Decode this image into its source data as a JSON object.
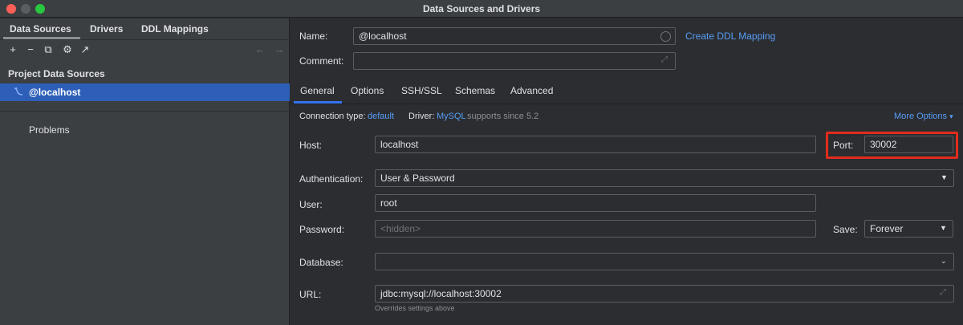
{
  "window": {
    "title": "Data Sources and Drivers"
  },
  "left": {
    "tabs": [
      {
        "label": "Data Sources"
      },
      {
        "label": "Drivers"
      },
      {
        "label": "DDL Mappings"
      }
    ],
    "toolbar": {
      "add": "+",
      "remove": "−",
      "duplicate": "⧉",
      "settings": "⚙",
      "export": "↗",
      "back": "←",
      "forward": "→"
    },
    "section_title": "Project Data Sources",
    "items": [
      {
        "label": "@localhost",
        "icon": "mysql-dolphin-icon"
      }
    ],
    "problems": "Problems"
  },
  "form": {
    "name_label": "Name:",
    "name_value": "@localhost",
    "create_ddl_link": "Create DDL Mapping",
    "comment_label": "Comment:",
    "comment_value": "",
    "tabs": [
      {
        "label": "General"
      },
      {
        "label": "Options"
      },
      {
        "label": "SSH/SSL"
      },
      {
        "label": "Schemas"
      },
      {
        "label": "Advanced"
      }
    ],
    "connection_type_label": "Connection type:",
    "connection_type_value": "default",
    "driver_label": "Driver:",
    "driver_value": "MySQL",
    "driver_note": "supports since 5.2",
    "more_options": "More Options",
    "host_label": "Host:",
    "host_value": "localhost",
    "port_label": "Port:",
    "port_value": "30002",
    "auth_label": "Authentication:",
    "auth_value": "User & Password",
    "user_label": "User:",
    "user_value": "root",
    "password_label": "Password:",
    "password_placeholder": "<hidden>",
    "save_label": "Save:",
    "save_value": "Forever",
    "database_label": "Database:",
    "database_value": "",
    "url_label": "URL:",
    "url_value": "jdbc:mysql://localhost:30002",
    "url_hint": "Overrides settings above"
  },
  "colors": {
    "accent": "#3574f0",
    "link": "#589df6",
    "selection": "#2e5fb8",
    "highlight": "#e22c1d"
  }
}
